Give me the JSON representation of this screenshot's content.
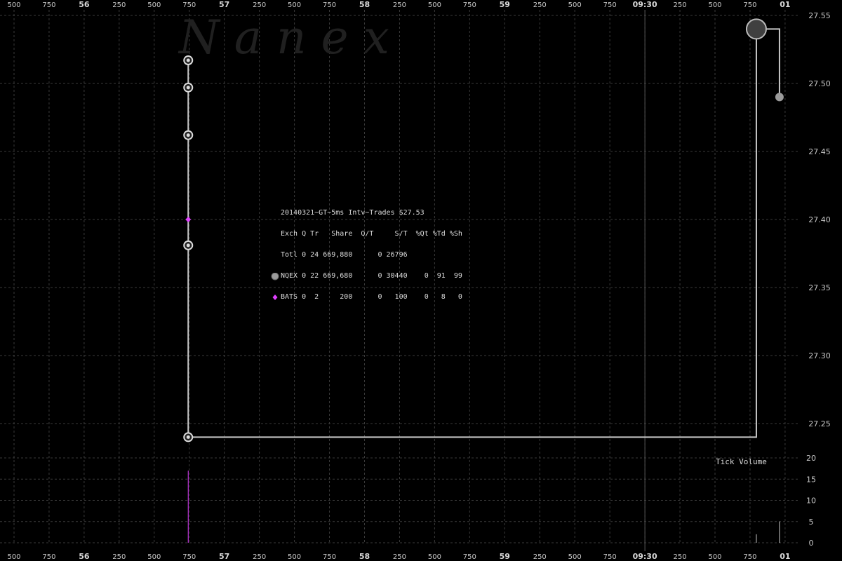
{
  "watermark": "N  a  n  e  x",
  "x_axis": {
    "ticks": [
      "500",
      "750",
      "56",
      "250",
      "500",
      "750",
      "57",
      "250",
      "500",
      "750",
      "58",
      "250",
      "500",
      "750",
      "59",
      "250",
      "500",
      "750",
      "09:30",
      "250",
      "500",
      "750",
      "01"
    ],
    "major": [
      "56",
      "57",
      "58",
      "59",
      "09:30",
      "01"
    ]
  },
  "price_axis": {
    "ticks": [
      "27.55",
      "27.50",
      "27.45",
      "27.40",
      "27.35",
      "27.30",
      "27.25"
    ]
  },
  "volume_axis": {
    "ticks": [
      "20",
      "15",
      "10",
      "5",
      "0"
    ]
  },
  "volume_label": "Tick Volume",
  "stats_box": {
    "title": "20140321~GT~5ms Intv~Trades $27.53",
    "header": "Exch Q Tr   Share  Q/T     S/T  %Qt %Td %Sh",
    "rows": [
      {
        "exchange": "Totl",
        "marker": "none",
        "text": "Totl 0 24 669,880      0 26796"
      },
      {
        "exchange": "NQEX",
        "marker": "gray-circle",
        "text": "NQEX 0 22 669,680      0 30440    0  91  99"
      },
      {
        "exchange": "BATS",
        "marker": "magenta-diamond",
        "text": "BATS 0  2     200      0   100    0   8   0"
      }
    ]
  },
  "colors": {
    "background": "#000000",
    "grid": "#3a3a3a",
    "line": "#c8c8c8",
    "nqex": "#9a9a9a",
    "bats": "#e040ff"
  },
  "chart_data": {
    "type": "scatter",
    "title": "20140321~GT~5ms Intv~Trades $27.53",
    "price_range": [
      27.22,
      27.56
    ],
    "x_ticks": [
      "500",
      "750",
      "56",
      "250",
      "500",
      "750",
      "57",
      "250",
      "500",
      "750",
      "58",
      "250",
      "500",
      "750",
      "59",
      "250",
      "500",
      "750",
      "09:30",
      "250",
      "500",
      "750",
      "01"
    ],
    "series": [
      {
        "name": "NQEX",
        "trades": [
          {
            "tick": 4.97,
            "price": 27.517,
            "size": "small"
          },
          {
            "tick": 4.97,
            "price": 27.497,
            "size": "small"
          },
          {
            "tick": 4.97,
            "price": 27.462,
            "size": "small"
          },
          {
            "tick": 4.97,
            "price": 27.381,
            "size": "small"
          },
          {
            "tick": 4.97,
            "price": 27.24,
            "size": "small"
          },
          {
            "tick": 21.18,
            "price": 27.54,
            "size": "large"
          },
          {
            "tick": 21.84,
            "price": 27.49,
            "size": "medium"
          }
        ]
      },
      {
        "name": "BATS",
        "trades": [
          {
            "tick": 4.97,
            "price": 27.4,
            "size": "small"
          }
        ]
      }
    ],
    "trade_line": [
      {
        "tick": 4.97,
        "price": 27.517
      },
      {
        "tick": 4.97,
        "price": 27.24
      },
      {
        "tick": 21.18,
        "price": 27.24
      },
      {
        "tick": 21.18,
        "price": 27.54
      },
      {
        "tick": 21.84,
        "price": 27.54
      },
      {
        "tick": 21.84,
        "price": 27.49
      }
    ],
    "tick_volume": [
      {
        "tick": 4.97,
        "value": 17,
        "color": "bats"
      },
      {
        "tick": 21.18,
        "value": 2,
        "color": "line"
      },
      {
        "tick": 21.84,
        "value": 5,
        "color": "line"
      }
    ],
    "volume_range": [
      0,
      20
    ],
    "markers_at_0930": true,
    "grid": true
  }
}
